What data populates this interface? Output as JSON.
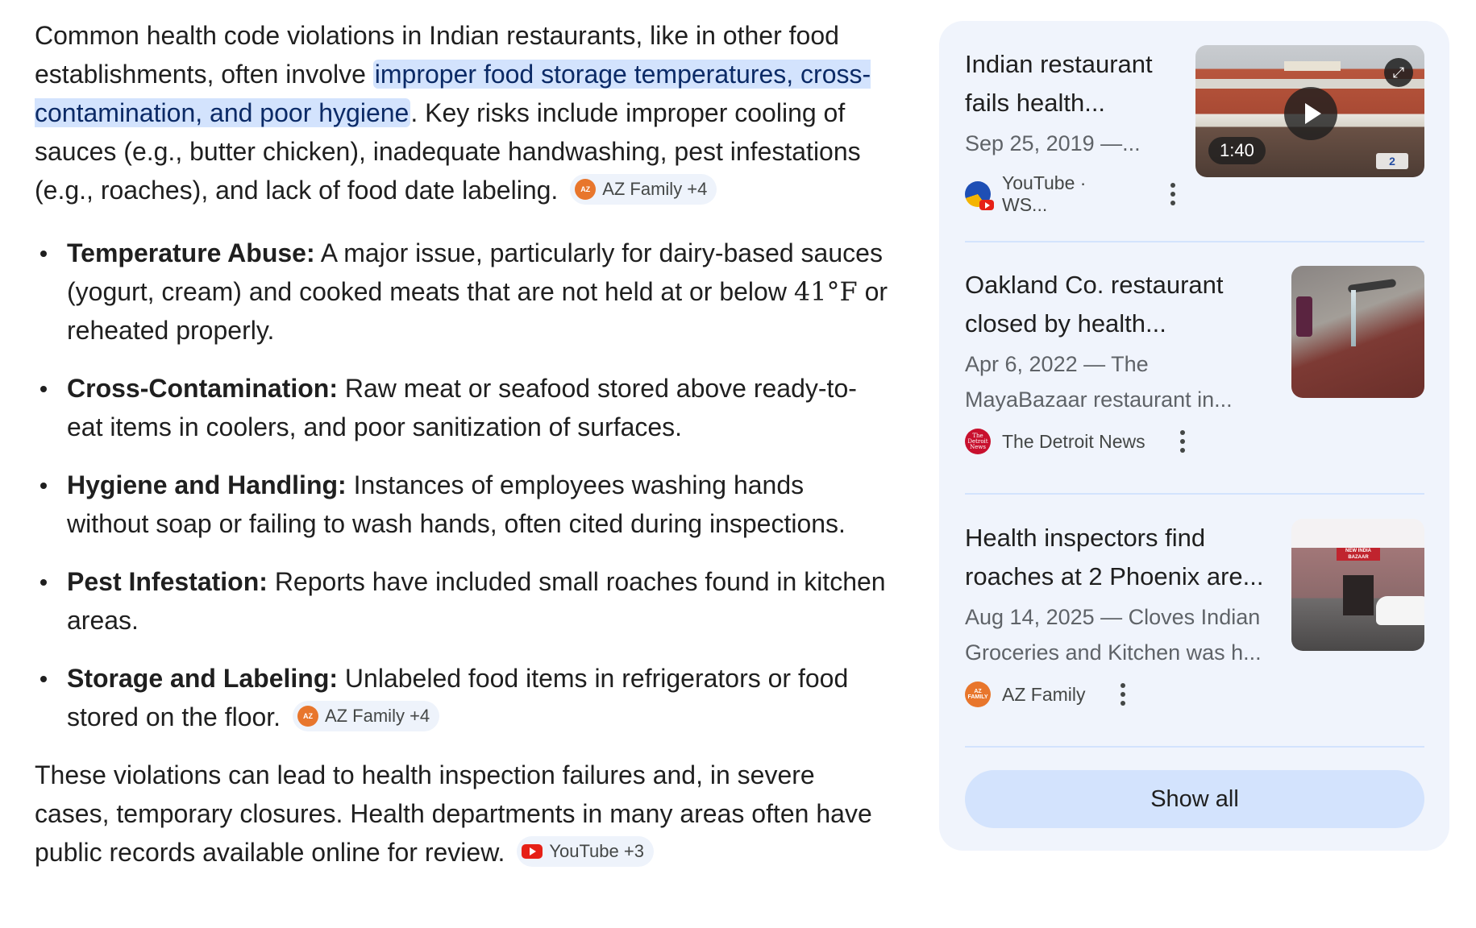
{
  "answer": {
    "intro_before": "Common health code violations in Indian restaurants, like in other food establishments, often involve ",
    "intro_highlight": "improper food storage temperatures, cross-contamination, and poor hygiene",
    "intro_after": ". Key risks include improper cooling of sauces (e.g., butter chicken), inadequate handwashing, pest infestations (e.g., roaches), and lack of food date labeling.",
    "intro_chip": {
      "icon": "AZ FAMILY",
      "label": "AZ Family +4"
    },
    "bullets": [
      {
        "term": "Temperature Abuse:",
        "text": " A major issue, particularly for dairy-based sauces (yogurt, cream) and cooked meats that are not held at or below ",
        "temp": "41°F",
        "text_after": " or reheated properly."
      },
      {
        "term": "Cross-Contamination:",
        "text": " Raw meat or seafood stored above ready-to-eat items in coolers, and poor sanitization of surfaces."
      },
      {
        "term": "Hygiene and Handling:",
        "text": " Instances of employees washing hands without soap or failing to wash hands, often cited during inspections."
      },
      {
        "term": "Pest Infestation:",
        "text": " Reports have included small roaches found in kitchen areas."
      },
      {
        "term": "Storage and Labeling:",
        "text": " Unlabeled food items in refrigerators or food stored on the floor."
      }
    ],
    "bullet_chip": {
      "icon": "AZ FAMILY",
      "label": "AZ Family +4"
    },
    "closing": "These violations can lead to health inspection failures and, in severe cases, temporary closures. Health departments in many areas often have public records available online for review.",
    "closing_chip": {
      "icon": "youtube-icon",
      "label": "YouTube +3"
    }
  },
  "sources": {
    "cards": [
      {
        "title_line1": "Indian restaurant",
        "title_line2": "fails health...",
        "meta_line1": "Sep 25, 2019 —...",
        "meta_line2": "",
        "source": "YouTube · WS...",
        "video_duration": "1:40"
      },
      {
        "title_line1": "Oakland Co. restaurant",
        "title_line2": "closed by health...",
        "meta_line1": "Apr 6, 2022 — The",
        "meta_line2": "MayaBazaar restaurant in...",
        "source": "The Detroit News",
        "logo_text": "The Detroit News"
      },
      {
        "title_line1": "Health inspectors find",
        "title_line2": "roaches at 2 Phoenix are...",
        "meta_line1": "Aug 14, 2025 — Cloves Indian",
        "meta_line2": "Groceries and Kitchen was h...",
        "source": "AZ Family",
        "logo_text": "AZ FAMILY",
        "sign_text": "NEW INDIA BAZAAR"
      }
    ],
    "show_all_label": "Show all"
  },
  "colors": {
    "highlight": "#d3e3fd",
    "panel_bg": "#f0f4fc",
    "chip_bg": "#eef3fb",
    "az_family": "#e8762c",
    "youtube": "#e62117",
    "detroit_news": "#c8102e"
  }
}
